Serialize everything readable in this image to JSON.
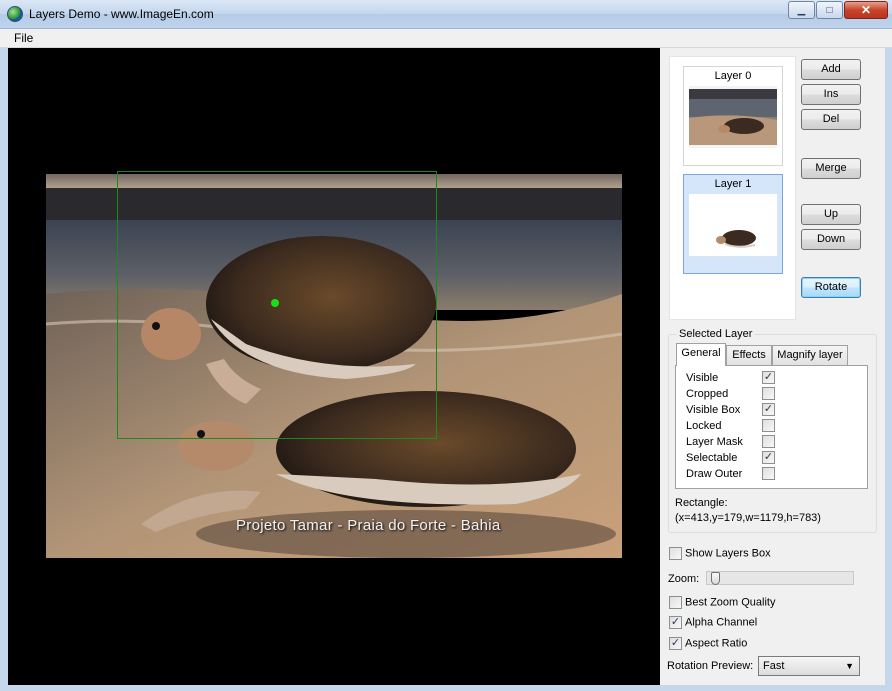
{
  "window": {
    "title": "Layers Demo  - www.ImageEn.com",
    "controls": {
      "minimize": "▁",
      "maximize": "□",
      "close": "✕"
    }
  },
  "menu": {
    "file": "File"
  },
  "viewer": {
    "caption": "Projeto Tamar - Praia do Forte - Bahia"
  },
  "layers": [
    {
      "label": "Layer 0",
      "selected": false
    },
    {
      "label": "Layer 1",
      "selected": true
    }
  ],
  "buttons": {
    "add": "Add",
    "ins": "Ins",
    "del": "Del",
    "merge": "Merge",
    "up": "Up",
    "down": "Down",
    "rotate": "Rotate"
  },
  "selected_layer": {
    "title": "Selected Layer",
    "tabs": [
      "General",
      "Effects",
      "Magnify layer"
    ],
    "active_tab": "General",
    "properties": [
      {
        "label": "Visible",
        "checked": true
      },
      {
        "label": "Cropped",
        "checked": false
      },
      {
        "label": "Visible Box",
        "checked": true
      },
      {
        "label": "Locked",
        "checked": false
      },
      {
        "label": "Layer Mask",
        "checked": false
      },
      {
        "label": "Selectable",
        "checked": true
      },
      {
        "label": "Draw Outer",
        "checked": false
      }
    ],
    "rectangle_label": "Rectangle:",
    "rectangle_value": "(x=413,y=179,w=1179,h=783)"
  },
  "options": {
    "show_layers_box": {
      "label": "Show Layers Box",
      "checked": false
    },
    "zoom_label": "Zoom:",
    "best_zoom_quality": {
      "label": "Best Zoom Quality",
      "checked": false
    },
    "alpha_channel": {
      "label": "Alpha Channel",
      "checked": true
    },
    "aspect_ratio": {
      "label": "Aspect Ratio",
      "checked": true
    },
    "rotation_preview_label": "Rotation Preview:",
    "rotation_preview_value": "Fast"
  },
  "colors": {
    "accent": "#3c7fb1",
    "selection_box": "#1b8a1b",
    "selection_dot": "#18e018",
    "viewer_bg": "#000000"
  },
  "icons": {
    "app": "imageen-globe-icon",
    "check": "✓",
    "dropdown": "▼"
  }
}
